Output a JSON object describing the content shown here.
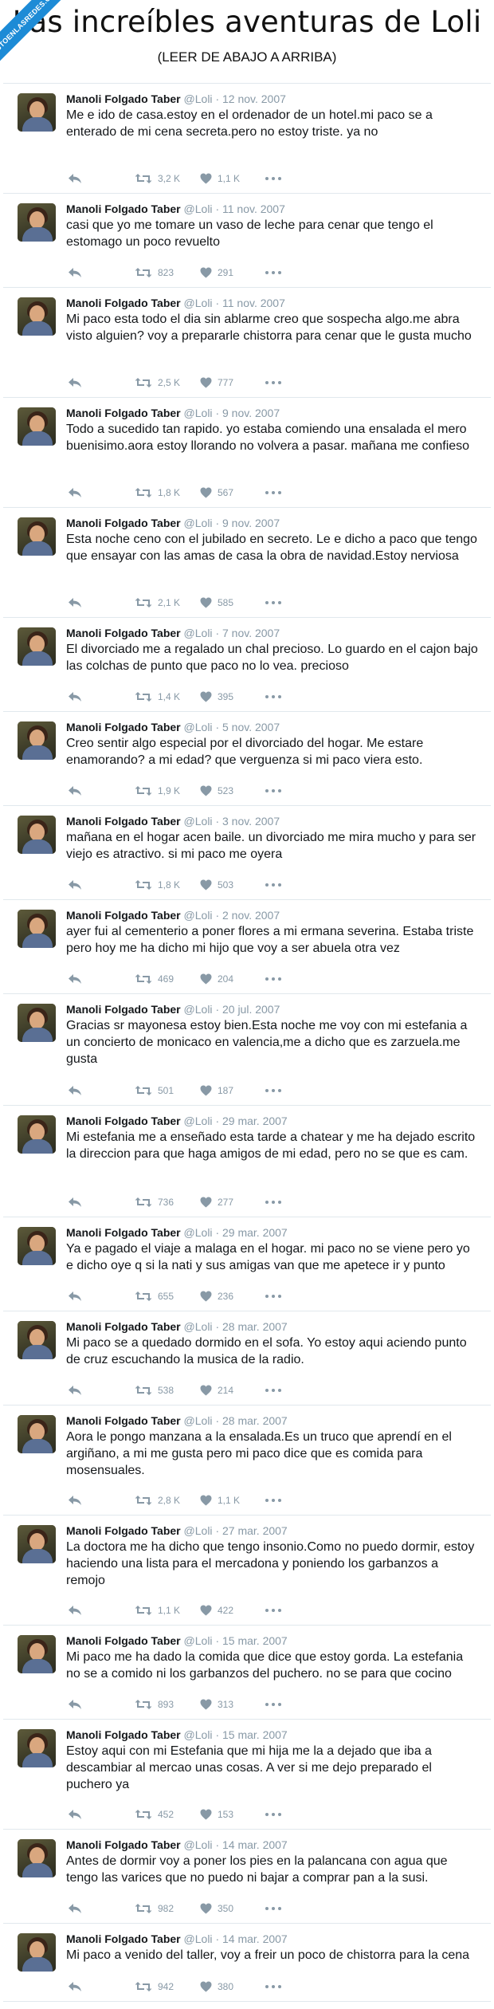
{
  "header": {
    "title": "Las increíbles aventuras de Loli",
    "subtitle": "(LEER DE ABAJO A ARRIBA)",
    "badge": "VISTOENLASREDES.COM"
  },
  "colors": {
    "muted": "#8899a6",
    "text": "#14171a",
    "border": "#e1e8ed",
    "badge": "#1d8bd6"
  },
  "icons": {
    "reply": "reply-icon",
    "retweet": "retweet-icon",
    "like": "heart-icon",
    "more": "more-dots-icon",
    "avatar": "profile-photo"
  },
  "tweets": [
    {
      "name": "Manoli Folgado Taber",
      "handle": "@Loli",
      "date": "· 12 nov. 2007",
      "text": "Me e ido de casa.estoy en el ordenador de un hotel.mi paco se a enterado de mi cena secreta.pero no estoy triste. ya no",
      "retweets": "3,2 K",
      "likes": "1,1 K"
    },
    {
      "name": "Manoli Folgado Taber",
      "handle": "@Loli",
      "date": "· 11 nov. 2007",
      "text": "casi que yo me tomare un vaso de leche para cenar que tengo el estomago un poco revuelto",
      "retweets": "823",
      "likes": "291"
    },
    {
      "name": "Manoli Folgado Taber",
      "handle": "@Loli",
      "date": "· 11 nov. 2007",
      "text": "Mi paco esta todo el dia sin ablarme creo que sospecha algo.me abra visto alguien? voy a prepararle chistorra para cenar que le gusta mucho",
      "retweets": "2,5 K",
      "likes": "777"
    },
    {
      "name": "Manoli Folgado Taber",
      "handle": "@Loli",
      "date": "· 9 nov. 2007",
      "text": "Todo a sucedido tan rapido. yo estaba comiendo una ensalada el mero buenisimo.aora estoy llorando no volvera a pasar. mañana me confieso",
      "retweets": "1,8 K",
      "likes": "567"
    },
    {
      "name": "Manoli Folgado Taber",
      "handle": "@Loli",
      "date": "· 9 nov. 2007",
      "text": "Esta noche ceno con el jubilado en secreto. Le e dicho a paco que tengo que ensayar con las amas de casa la obra de navidad.Estoy nerviosa",
      "retweets": "2,1 K",
      "likes": "585"
    },
    {
      "name": "Manoli Folgado Taber",
      "handle": "@Loli",
      "date": "· 7 nov. 2007",
      "text": "El divorciado me a regalado un chal precioso. Lo guardo en el cajon bajo las colchas de punto que paco no lo vea. precioso",
      "retweets": "1,4 K",
      "likes": "395"
    },
    {
      "name": "Manoli Folgado Taber",
      "handle": "@Loli",
      "date": "· 5 nov. 2007",
      "text": "Creo sentir algo especial por el divorciado del hogar. Me estare enamorando? a mi edad? que verguenza si mi paco viera esto.",
      "retweets": "1,9 K",
      "likes": "523"
    },
    {
      "name": "Manoli Folgado Taber",
      "handle": "@Loli",
      "date": "· 3 nov. 2007",
      "text": "mañana en el hogar acen baile. un divorciado me mira mucho y para ser viejo es atractivo. si mi paco me oyera",
      "retweets": "1,8 K",
      "likes": "503"
    },
    {
      "name": "Manoli Folgado Taber",
      "handle": "@Loli",
      "date": "· 2 nov. 2007",
      "text": "ayer fui al cementerio a poner flores a mi ermana severina. Estaba triste pero hoy me ha dicho mi hijo que voy a ser abuela otra vez",
      "retweets": "469",
      "likes": "204"
    },
    {
      "name": "Manoli Folgado Taber",
      "handle": "@Loli",
      "date": "· 20 jul. 2007",
      "text": "Gracias sr mayonesa estoy bien.Esta noche me voy con mi estefania a un concierto de monicaco en valencia,me a dicho que es zarzuela.me gusta",
      "retweets": "501",
      "likes": "187"
    },
    {
      "name": "Manoli Folgado Taber",
      "handle": "@Loli",
      "date": "· 29 mar. 2007",
      "text": "Mi estefania me a enseñado esta tarde a chatear y me ha dejado escrito la direccion para que haga amigos de mi edad, pero no se que es cam.",
      "retweets": "736",
      "likes": "277"
    },
    {
      "name": "Manoli Folgado Taber",
      "handle": "@Loli",
      "date": "· 29 mar. 2007",
      "text": "Ya e pagado el viaje a malaga en el hogar. mi paco no se viene pero yo e dicho oye q si la nati y sus amigas van que me apetece ir y punto",
      "retweets": "655",
      "likes": "236"
    },
    {
      "name": "Manoli Folgado Taber",
      "handle": "@Loli",
      "date": "· 28 mar. 2007",
      "text": "Mi paco se a quedado dormido en el sofa. Yo estoy aqui aciendo punto de cruz escuchando la musica de la radio.",
      "retweets": "538",
      "likes": "214"
    },
    {
      "name": "Manoli Folgado Taber",
      "handle": "@Loli",
      "date": "· 28 mar. 2007",
      "text": "Aora le pongo manzana a la ensalada.Es un truco que aprendí en el argiñano, a mi me gusta pero mi paco dice que es comida para mosensuales.",
      "retweets": "2,8 K",
      "likes": "1,1 K"
    },
    {
      "name": "Manoli Folgado Taber",
      "handle": "@Loli",
      "date": "· 27 mar. 2007",
      "text": "La doctora me ha dicho que tengo insonio.Como no puedo dormir, estoy haciendo una lista para el mercadona y poniendo los garbanzos a remojo",
      "retweets": "1,1 K",
      "likes": "422"
    },
    {
      "name": "Manoli Folgado Taber",
      "handle": "@Loli",
      "date": "· 15 mar. 2007",
      "text": "Mi paco me ha dado la comida que dice que estoy gorda. La estefania no se a comido ni los garbanzos del puchero. no se para que cocino",
      "retweets": "893",
      "likes": "313"
    },
    {
      "name": "Manoli Folgado Taber",
      "handle": "@Loli",
      "date": "· 15 mar. 2007",
      "text": "Estoy aqui con mi Estefania que mi hija me la a dejado que iba a descambiar al mercao unas cosas. A ver si me dejo preparado el puchero ya",
      "retweets": "452",
      "likes": "153"
    },
    {
      "name": "Manoli Folgado Taber",
      "handle": "@Loli",
      "date": "· 14 mar. 2007",
      "text": "Antes de dormir voy a poner los pies en la palancana con agua que tengo las varices que no puedo ni bajar a comprar pan a la susi.",
      "retweets": "982",
      "likes": "350"
    },
    {
      "name": "Manoli Folgado Taber",
      "handle": "@Loli",
      "date": "· 14 mar. 2007",
      "text": "Mi paco a venido del taller, voy a freir un poco de chistorra para la cena",
      "retweets": "942",
      "likes": "380"
    }
  ]
}
